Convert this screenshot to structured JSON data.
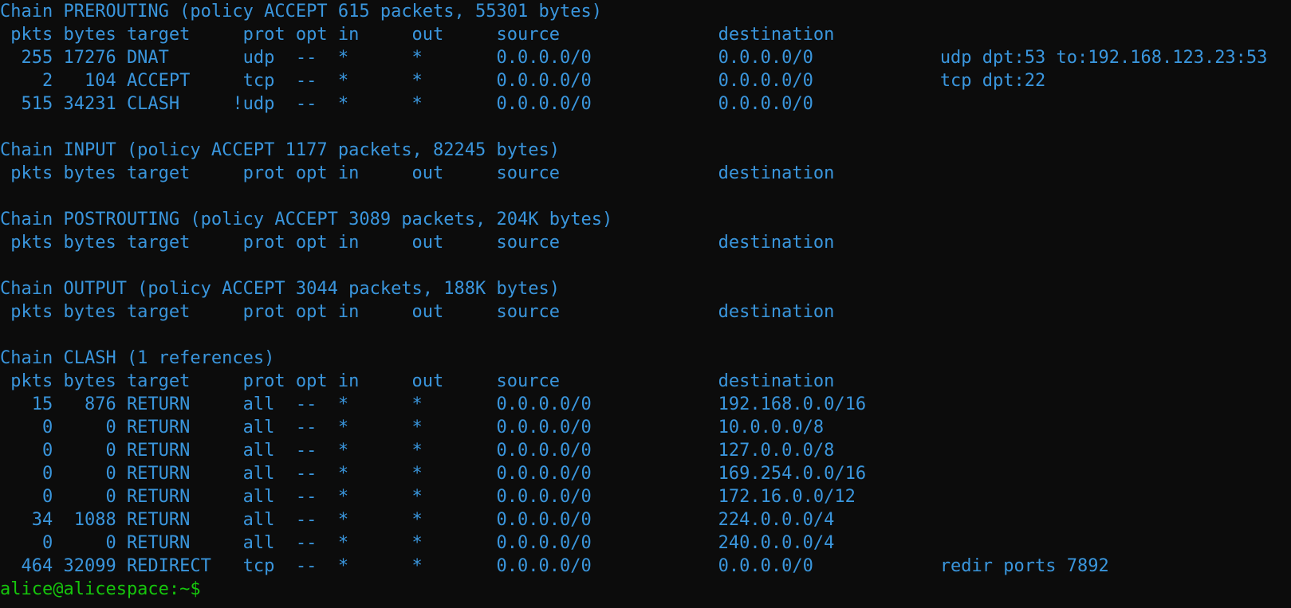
{
  "terminal": {
    "output": [
      "Chain PREROUTING (policy ACCEPT 615 packets, 55301 bytes)",
      " pkts bytes target     prot opt in     out     source               destination",
      "  255 17276 DNAT       udp  --  *      *       0.0.0.0/0            0.0.0.0/0            udp dpt:53 to:192.168.123.23:53",
      "    2   104 ACCEPT     tcp  --  *      *       0.0.0.0/0            0.0.0.0/0            tcp dpt:22",
      "  515 34231 CLASH     !udp  --  *      *       0.0.0.0/0            0.0.0.0/0",
      "",
      "Chain INPUT (policy ACCEPT 1177 packets, 82245 bytes)",
      " pkts bytes target     prot opt in     out     source               destination",
      "",
      "Chain POSTROUTING (policy ACCEPT 3089 packets, 204K bytes)",
      " pkts bytes target     prot opt in     out     source               destination",
      "",
      "Chain OUTPUT (policy ACCEPT 3044 packets, 188K bytes)",
      " pkts bytes target     prot opt in     out     source               destination",
      "",
      "Chain CLASH (1 references)",
      " pkts bytes target     prot opt in     out     source               destination",
      "   15   876 RETURN     all  --  *      *       0.0.0.0/0            192.168.0.0/16",
      "    0     0 RETURN     all  --  *      *       0.0.0.0/0            10.0.0.0/8",
      "    0     0 RETURN     all  --  *      *       0.0.0.0/0            127.0.0.0/8",
      "    0     0 RETURN     all  --  *      *       0.0.0.0/0            169.254.0.0/16",
      "    0     0 RETURN     all  --  *      *       0.0.0.0/0            172.16.0.0/12",
      "   34  1088 RETURN     all  --  *      *       0.0.0.0/0            224.0.0.0/4",
      "    0     0 RETURN     all  --  *      *       0.0.0.0/0            240.0.0.0/4",
      "  464 32099 REDIRECT   tcp  --  *      *       0.0.0.0/0            0.0.0.0/0            redir ports 7892"
    ],
    "prompt": "alice@alicespace:~$"
  },
  "colors": {
    "background": "#0c0c0c",
    "output_text": "#3a96dd",
    "prompt_text": "#16c60c"
  }
}
